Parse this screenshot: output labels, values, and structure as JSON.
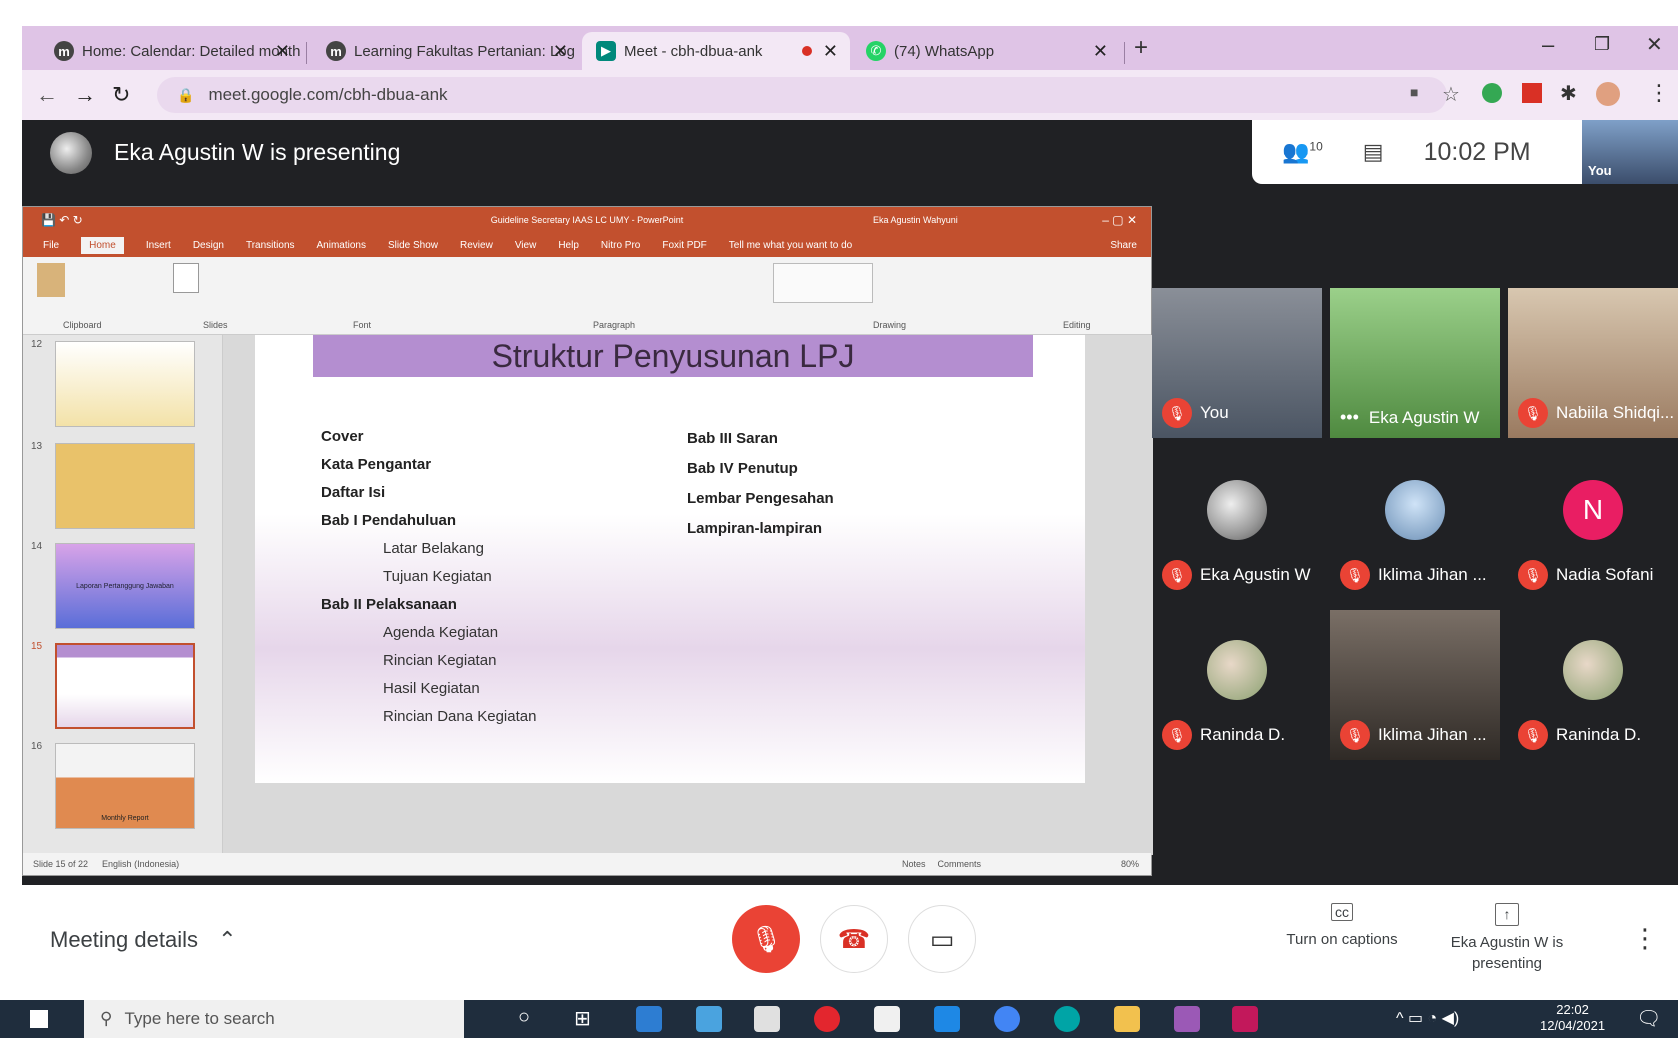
{
  "browser": {
    "tabs": [
      {
        "label": "Home: Calendar: Detailed month",
        "favicon": "m"
      },
      {
        "label": "Learning Fakultas Pertanian: Log",
        "favicon": "m"
      },
      {
        "label": "Meet - cbh-dbua-ank",
        "favicon": "meet"
      },
      {
        "label": "(74) WhatsApp",
        "favicon": "wa"
      }
    ],
    "url": "meet.google.com/cbh-dbua-ank"
  },
  "meet": {
    "presenting_banner": "Eka Agustin W is presenting",
    "participant_count": "10",
    "clock": "10:02 PM",
    "self_label": "You",
    "participants": [
      {
        "name": "You",
        "muted": true
      },
      {
        "name": "Eka Agustin W",
        "muted": false
      },
      {
        "name": "Nabiila Shidqi...",
        "muted": true
      },
      {
        "name": "Eka Agustin W",
        "muted": true
      },
      {
        "name": "Iklima Jihan ...",
        "muted": true
      },
      {
        "name": "Nadia Sofani",
        "muted": true,
        "initial": "N"
      },
      {
        "name": "Raninda D.",
        "muted": true
      },
      {
        "name": "Iklima Jihan ...",
        "muted": true
      },
      {
        "name": "Raninda D.",
        "muted": true
      }
    ],
    "meeting_details": "Meeting details",
    "captions_label": "Turn on captions",
    "presenting_label": "Eka Agustin W is presenting"
  },
  "powerpoint": {
    "window_title": "Guideline Secretary IAAS LC UMY - PowerPoint",
    "user": "Eka Agustin Wahyuni",
    "tabs": [
      "File",
      "Home",
      "Insert",
      "Design",
      "Transitions",
      "Animations",
      "Slide Show",
      "Review",
      "View",
      "Help",
      "Nitro Pro",
      "Foxit PDF"
    ],
    "tell_me": "Tell me what you want to do",
    "share": "Share",
    "groups": [
      "Clipboard",
      "Slides",
      "Font",
      "Paragraph",
      "Drawing",
      "Editing"
    ],
    "slide_numbers": [
      "12",
      "13",
      "14",
      "15",
      "16"
    ],
    "thumb_14_text": "Laporan Pertanggung Jawaban",
    "thumb_16_text": "Monthly Report",
    "status": "Slide 15 of 22",
    "language": "English (Indonesia)",
    "notes": "Notes",
    "comments": "Comments",
    "zoom": "80%",
    "slide": {
      "title": "Struktur Penyusunan LPJ",
      "left_col": [
        {
          "text": "Cover",
          "indent": false
        },
        {
          "text": "Kata Pengantar",
          "indent": false
        },
        {
          "text": "Daftar Isi",
          "indent": false
        },
        {
          "text": "Bab I Pendahuluan",
          "indent": false
        },
        {
          "text": "Latar Belakang",
          "indent": true
        },
        {
          "text": "Tujuan Kegiatan",
          "indent": true
        },
        {
          "text": "Bab II Pelaksanaan",
          "indent": false
        },
        {
          "text": "Agenda Kegiatan",
          "indent": true
        },
        {
          "text": "Rincian Kegiatan",
          "indent": true
        },
        {
          "text": "Hasil Kegiatan",
          "indent": true
        },
        {
          "text": "Rincian Dana Kegiatan",
          "indent": true
        }
      ],
      "right_col": [
        "Bab III Saran",
        "Bab IV Penutup",
        "Lembar Pengesahan",
        "Lampiran-lampiran"
      ]
    }
  },
  "taskbar": {
    "search_placeholder": "Type here to search",
    "time": "22:02",
    "date": "12/04/2021"
  },
  "colors": {
    "tab_bar": "#dfc4e6",
    "meet_bg": "#202124",
    "mute_red": "#ea4335",
    "ppt_orange": "#c2502e",
    "slide_title_bar": "#b48ed0"
  }
}
